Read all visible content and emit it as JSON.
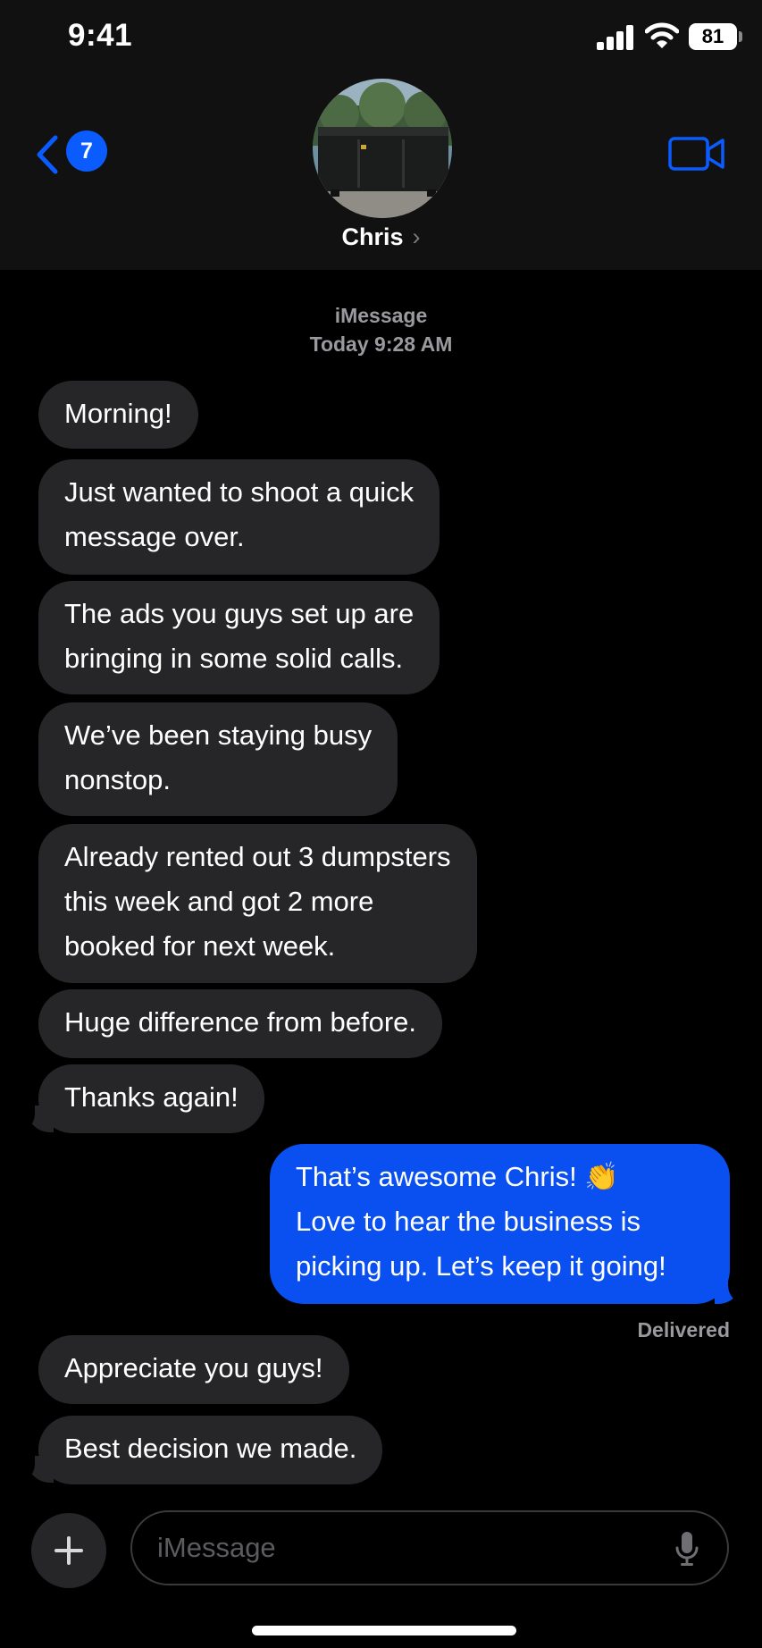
{
  "status_bar": {
    "time": "9:41",
    "battery": "81"
  },
  "header": {
    "back_count": "7",
    "contact_name": "Chris",
    "chevron": "›"
  },
  "thread": {
    "service": "iMessage",
    "timestamp": "Today 9:28 AM",
    "messages": [
      {
        "dir": "received",
        "text": "Morning!"
      },
      {
        "dir": "received",
        "text": "Just wanted to shoot a quick\nmessage over."
      },
      {
        "dir": "received",
        "text": "The ads you guys set up are\nbringing in some solid calls."
      },
      {
        "dir": "received",
        "text": "We’ve been staying busy\nnonstop."
      },
      {
        "dir": "received",
        "text": "Already rented out 3 dumpsters\nthis week and got 2 more\nbooked for next week."
      },
      {
        "dir": "received",
        "text": "Huge difference from before."
      },
      {
        "dir": "received",
        "text": "Thanks again!"
      },
      {
        "dir": "sent",
        "text": "That’s awesome Chris! 👏\nLove to hear the business is\npicking up. Let’s keep it going!"
      },
      {
        "dir": "received",
        "text": "Appreciate you guys!"
      },
      {
        "dir": "received",
        "text": "Best decision we made."
      }
    ],
    "delivered": "Delivered"
  },
  "composer": {
    "placeholder": "iMessage"
  },
  "colors": {
    "sent_bubble": "#0a4ff0",
    "received_bubble": "#262628",
    "accent": "#0a5cff"
  },
  "icons": [
    "back-chevron-icon",
    "video-call-icon",
    "plus-icon",
    "microphone-icon",
    "cellular-signal-icon",
    "wifi-icon",
    "battery-icon"
  ]
}
